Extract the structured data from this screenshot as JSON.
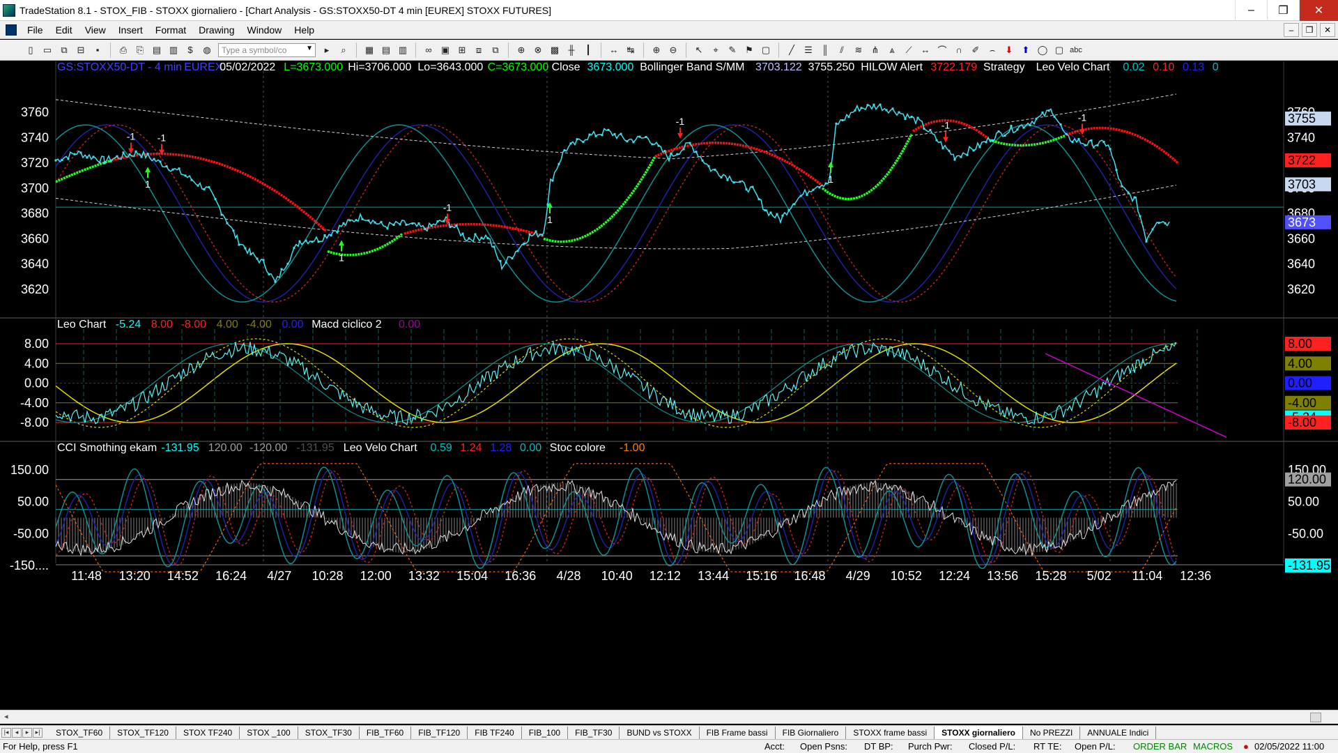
{
  "window": {
    "title": "TradeStation 8.1 - STOX_FIB - STOXX giornaliero - [Chart Analysis - GS:STOXX50-DT  4 min  [EUREX] STOXX FUTURES]",
    "minimize": "–",
    "maximize": "❒",
    "close": "✕"
  },
  "menu": [
    "File",
    "Edit",
    "View",
    "Insert",
    "Format",
    "Drawing",
    "Window",
    "Help"
  ],
  "mdi_buttons": [
    "–",
    "❒",
    "✕"
  ],
  "toolbar": {
    "symbol_placeholder": "Type a symbol/co",
    "abc_label": "abc"
  },
  "price_pane": {
    "legend": [
      {
        "text": "GS:STOXX50-DT - 4 min",
        "color": "#4040ff"
      },
      {
        "text": "EUREX",
        "color": "#4040ff"
      },
      {
        "text": "05/02/2022",
        "color": "#ffffff"
      },
      {
        "text": "L=3673.000",
        "color": "#00ff00"
      },
      {
        "text": "Hi=3706.000",
        "color": "#ffffff"
      },
      {
        "text": "Lo=3643.000",
        "color": "#ffffff"
      },
      {
        "text": "C=3673.000",
        "color": "#00ff00"
      },
      {
        "text": "Close",
        "color": "#ffffff"
      },
      {
        "text": "3673.000",
        "color": "#00ffff"
      },
      {
        "text": "Bollinger Band S/MM",
        "color": "#ffffff"
      },
      {
        "text": "3703.122",
        "color": "#c0c0ff"
      },
      {
        "text": "3755.250",
        "color": "#ffffff"
      },
      {
        "text": "HILOW Alert",
        "color": "#ffffff"
      },
      {
        "text": "3722.179",
        "color": "#ff2020"
      },
      {
        "text": "Strategy",
        "color": "#ffffff"
      },
      {
        "text": "Leo Velo Chart",
        "color": "#ffffff"
      },
      {
        "text": "0.02",
        "color": "#00c0c0"
      },
      {
        "text": "0.10",
        "color": "#ff2020"
      },
      {
        "text": "0.13",
        "color": "#2020ff"
      },
      {
        "text": "0",
        "color": "#00c0c0"
      }
    ],
    "y_ticks": [
      "3760",
      "3740",
      "3720",
      "3700",
      "3680",
      "3660",
      "3640",
      "3620"
    ],
    "right_ticks": [
      "3760",
      "3740",
      "3720",
      "3700",
      "3680",
      "3660",
      "3640",
      "3620"
    ],
    "price_tags": [
      {
        "text": "3755",
        "bg": "#c8d8f0",
        "fg": "#000000",
        "value": 3755
      },
      {
        "text": "3722",
        "bg": "#ff2020",
        "fg": "#000000",
        "value": 3722
      },
      {
        "text": "3703",
        "bg": "#c8d8f0",
        "fg": "#000000",
        "value": 3703
      },
      {
        "text": "3673",
        "bg": "#5050ff",
        "fg": "#ffffff",
        "value": 3673
      }
    ],
    "signals": [
      "-1",
      "-1",
      "1",
      "1",
      "-1",
      "1",
      "-1",
      "1",
      "-1",
      "-1"
    ]
  },
  "macd_pane": {
    "legend": [
      {
        "text": "Leo Chart",
        "color": "#ffffff"
      },
      {
        "text": "-5.24",
        "color": "#00ffff"
      },
      {
        "text": "8.00",
        "color": "#ff2020"
      },
      {
        "text": "-8.00",
        "color": "#ff2020"
      },
      {
        "text": "4.00",
        "color": "#808000"
      },
      {
        "text": "-4.00",
        "color": "#808000"
      },
      {
        "text": "0.00",
        "color": "#2020ff"
      },
      {
        "text": "Macd ciclico 2",
        "color": "#ffffff"
      },
      {
        "text": "0.00",
        "color": "#a000a0"
      }
    ],
    "y_ticks": [
      "8.00",
      "4.00",
      "0.00",
      "-4.00",
      "-8.00"
    ],
    "right_tags": [
      {
        "text": "8.00",
        "bg": "#ff2020",
        "fg": "#000000"
      },
      {
        "text": "4.00",
        "bg": "#808000",
        "fg": "#000000"
      },
      {
        "text": "0.00",
        "bg": "#2020ff",
        "fg": "#000000"
      },
      {
        "text": "-4.00",
        "bg": "#808000",
        "fg": "#000000"
      },
      {
        "text": "-5.24",
        "bg": "#00ffff",
        "fg": "#000000"
      },
      {
        "text": "-8.00",
        "bg": "#ff2020",
        "fg": "#000000"
      }
    ]
  },
  "cci_pane": {
    "legend": [
      {
        "text": "CCI Smothing ekam",
        "color": "#ffffff"
      },
      {
        "text": "-131.95",
        "color": "#00ffff"
      },
      {
        "text": "120.00",
        "color": "#a0a0a0"
      },
      {
        "text": "-120.00",
        "color": "#a0a0a0"
      },
      {
        "text": "-131.95",
        "color": "#505050"
      },
      {
        "text": "Leo Velo Chart",
        "color": "#ffffff"
      },
      {
        "text": "0.59",
        "color": "#00c0c0"
      },
      {
        "text": "1.24",
        "color": "#ff2020"
      },
      {
        "text": "1.28",
        "color": "#2020ff"
      },
      {
        "text": "0.00",
        "color": "#00c0c0"
      },
      {
        "text": "Stoc colore",
        "color": "#ffffff"
      },
      {
        "text": "-1.00",
        "color": "#ff8000"
      }
    ],
    "y_ticks": [
      "150.00",
      "50.00",
      "-50.00",
      "-150...."
    ],
    "right_tags": [
      {
        "text": "150.00",
        "bg": "#000000",
        "fg": "#ffffff"
      },
      {
        "text": "120.00",
        "bg": "#a0a0a0",
        "fg": "#000000"
      },
      {
        "text": "50.00",
        "bg": "#000000",
        "fg": "#ffffff"
      },
      {
        "text": "-50.00",
        "bg": "#000000",
        "fg": "#ffffff"
      },
      {
        "text": "-131.95",
        "bg": "#00ffff",
        "fg": "#000000"
      }
    ]
  },
  "x_axis": [
    "11:48",
    "13:20",
    "14:52",
    "16:24",
    "4/27",
    "10:28",
    "12:00",
    "13:32",
    "15:04",
    "16:36",
    "4/28",
    "10:40",
    "12:12",
    "13:44",
    "15:16",
    "16:48",
    "4/29",
    "10:52",
    "12:24",
    "13:56",
    "15:28",
    "5/02",
    "11:04",
    "12:36"
  ],
  "sheet_tabs": [
    "STOX_TF60",
    "STOX_TF120",
    "STOX TF240",
    "STOX _100",
    "STOX_TF30",
    "FIB_TF60",
    "FIB_TF120",
    "FIB TF240",
    "FIB_100",
    "FIB_TF30",
    "BUND vs STOXX",
    "FIB Frame bassi",
    "FIB Giornaliero",
    "STOXX frame bassi",
    "STOXX giornaliero",
    "No PREZZI",
    "ANNUALE Indici"
  ],
  "active_tab": "STOXX giornaliero",
  "status": {
    "help": "For Help, press F1",
    "acct": "Acct:",
    "open_psns": "Open Psns:",
    "dt_bp": "DT BP:",
    "purch_pwr": "Purch Pwr:",
    "closed_pl": "Closed P/L:",
    "rt_te": "RT TE:",
    "open_pl": "Open P/L:",
    "order_bar": "ORDER BAR",
    "macros": "MACROS",
    "datetime": "02/05/2022 11:00"
  },
  "colors": {
    "price": "#40e0f0",
    "bb_white": "#d0d0e0",
    "cycle_teal": "#109090",
    "cycle_blue": "#2020a0",
    "cycle_red": "#c02020",
    "strat_green": "#20ff20",
    "strat_red": "#ff1010",
    "grid_hline": "#00a0a0"
  }
}
